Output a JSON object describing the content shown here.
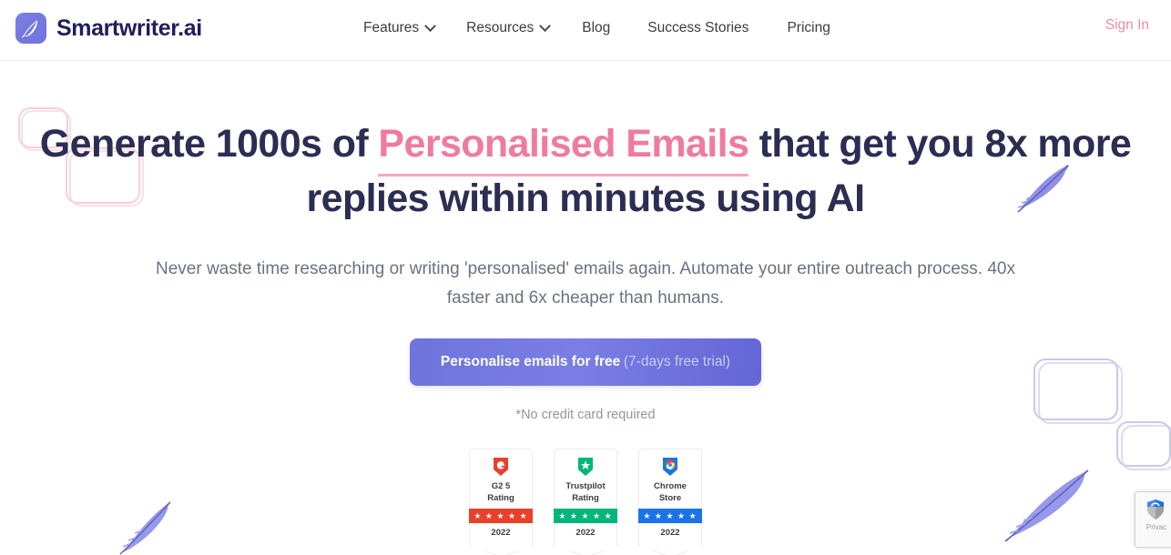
{
  "brand": {
    "name": "Smartwriter.ai",
    "logo_icon": "feather-icon"
  },
  "nav": {
    "items": [
      {
        "label": "Features",
        "has_dropdown": true
      },
      {
        "label": "Resources",
        "has_dropdown": true
      },
      {
        "label": "Blog",
        "has_dropdown": false
      },
      {
        "label": "Success Stories",
        "has_dropdown": false
      },
      {
        "label": "Pricing",
        "has_dropdown": false
      }
    ],
    "sign_in": "Sign In"
  },
  "hero": {
    "headline_part1": "Generate 1000s of ",
    "headline_accent": "Personalised Emails",
    "headline_part2": " that get you 8x more replies within minutes using AI",
    "subheading": "Never waste time researching or writing 'personalised' emails again. Automate your entire outreach process. 40x faster and 6x cheaper than humans.",
    "cta_main": "Personalise emails for free",
    "cta_sub": "(7-days free trial)",
    "no_card": "*No credit card required"
  },
  "badges": [
    {
      "title_line1": "G2 5",
      "title_line2": "Rating",
      "year": "2022",
      "stars": "★ ★ ★ ★ ★",
      "color": "#e8402a",
      "icon": "g2-shield-icon"
    },
    {
      "title_line1": "Trustpilot",
      "title_line2": "Rating",
      "year": "2022",
      "stars": "★ ★ ★ ★ ★",
      "color": "#00b67a",
      "icon": "trustpilot-shield-icon"
    },
    {
      "title_line1": "Chrome",
      "title_line2": "Store",
      "year": "2022",
      "stars": "★ ★ ★ ★ ★",
      "color": "#1a73e8",
      "icon": "chrome-shield-icon"
    }
  ],
  "recaptcha": {
    "label": "Privac",
    "icon": "recaptcha-icon"
  },
  "colors": {
    "brand_navy": "#211d5e",
    "accent_pink": "#ef7b9e",
    "accent_purple": "#6f74dd",
    "heading_navy": "#2b2d52",
    "body_gray": "#6b7280",
    "signin_pink": "#ef8aa6"
  }
}
